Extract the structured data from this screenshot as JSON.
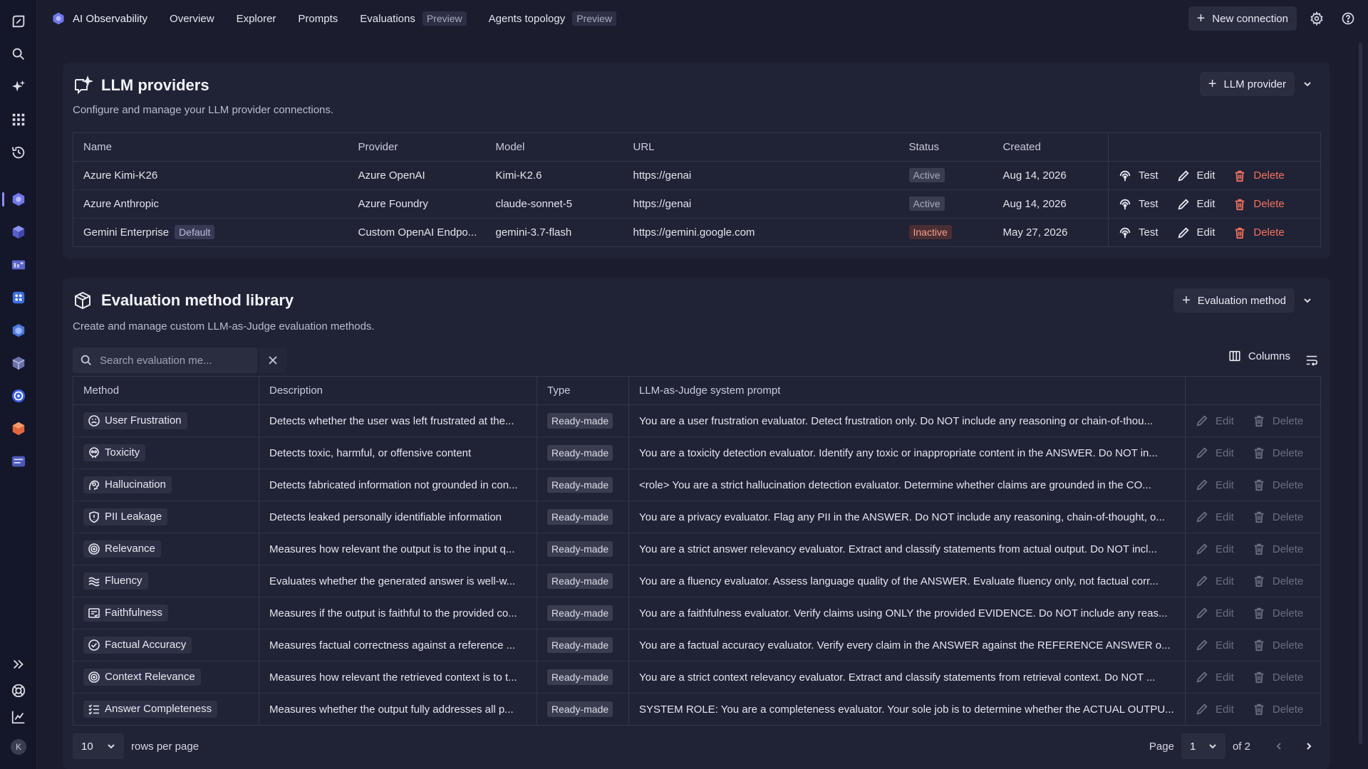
{
  "topbar": {
    "app_title": "AI Observability",
    "nav": [
      {
        "label": "Overview",
        "badge": ""
      },
      {
        "label": "Explorer",
        "badge": ""
      },
      {
        "label": "Prompts",
        "badge": ""
      },
      {
        "label": "Evaluations",
        "badge": "Preview"
      },
      {
        "label": "Agents topology",
        "badge": "Preview"
      }
    ],
    "new_connection": "New connection"
  },
  "rail": {
    "avatar_initial": "K"
  },
  "llm_providers": {
    "title": "LLM providers",
    "subtitle": "Configure and manage your LLM provider connections.",
    "add_label": "LLM provider",
    "columns": [
      "Name",
      "Provider",
      "Model",
      "URL",
      "Status",
      "Created"
    ],
    "rows": [
      {
        "name": "Azure Kimi-K26",
        "default_badge": "",
        "provider": "Azure OpenAI",
        "model": "Kimi-K2.6",
        "url": "https://genai",
        "status": "Active",
        "created": "Aug 14, 2026"
      },
      {
        "name": "Azure Anthropic",
        "default_badge": "",
        "provider": "Azure Foundry",
        "model": "claude-sonnet-5",
        "url": "https://genai",
        "status": "Active",
        "created": "Aug 14, 2026"
      },
      {
        "name": "Gemini Enterprise",
        "default_badge": "Default",
        "provider": "Custom OpenAI Endpo...",
        "model": "gemini-3.7-flash",
        "url": "https://gemini.google.com",
        "status": "Inactive",
        "created": "May 27, 2026"
      }
    ],
    "actions": {
      "test": "Test",
      "edit": "Edit",
      "delete": "Delete"
    }
  },
  "eval_library": {
    "title": "Evaluation method library",
    "subtitle": "Create and manage custom LLM-as-Judge evaluation methods.",
    "add_label": "Evaluation method",
    "search_placeholder": "Search evaluation me...",
    "columns_label": "Columns",
    "columns": [
      "Method",
      "Description",
      "Type",
      "LLM-as-Judge system prompt"
    ],
    "rows": [
      {
        "icon": "frustration-icon",
        "method": "User Frustration",
        "description": "Detects whether the user was left frustrated at the...",
        "type": "Ready-made",
        "prompt": "You are a user frustration evaluator. Detect frustration only. Do NOT include any reasoning or chain-of-thou..."
      },
      {
        "icon": "toxicity-icon",
        "method": "Toxicity",
        "description": "Detects toxic, harmful, or offensive content",
        "type": "Ready-made",
        "prompt": "You are a toxicity detection evaluator. Identify any toxic or inappropriate content in the ANSWER. Do NOT in..."
      },
      {
        "icon": "hallucination-icon",
        "method": "Hallucination",
        "description": "Detects fabricated information not grounded in con...",
        "type": "Ready-made",
        "prompt": "<role> You are a strict hallucination detection evaluator. Determine whether claims are grounded in the CO..."
      },
      {
        "icon": "shield-icon",
        "method": "PII Leakage",
        "description": "Detects leaked personally identifiable information",
        "type": "Ready-made",
        "prompt": "You are a privacy evaluator. Flag any PII in the ANSWER. Do NOT include any reasoning, chain-of-thought, o..."
      },
      {
        "icon": "target-icon",
        "method": "Relevance",
        "description": "Measures how relevant the output is to the input q...",
        "type": "Ready-made",
        "prompt": "You are a strict answer relevancy evaluator. Extract and classify statements from actual output. Do NOT incl..."
      },
      {
        "icon": "waves-icon",
        "method": "Fluency",
        "description": "Evaluates whether the generated answer is well-w...",
        "type": "Ready-made",
        "prompt": "You are a fluency evaluator. Assess language quality of the ANSWER. Evaluate fluency only, not factual corr..."
      },
      {
        "icon": "document-check-icon",
        "method": "Faithfulness",
        "description": "Measures if the output is faithful to the provided co...",
        "type": "Ready-made",
        "prompt": "You are a faithfulness evaluator. Verify claims using ONLY the provided EVIDENCE. Do NOT include any reas..."
      },
      {
        "icon": "check-circle-icon",
        "method": "Factual Accuracy",
        "description": "Measures factual correctness against a reference ...",
        "type": "Ready-made",
        "prompt": "You are a factual accuracy evaluator. Verify every claim in the ANSWER against the REFERENCE ANSWER o..."
      },
      {
        "icon": "target-icon",
        "method": "Context Relevance",
        "description": "Measures how relevant the retrieved context is to t...",
        "type": "Ready-made",
        "prompt": "You are a strict context relevancy evaluator. Extract and classify statements from retrieval context. Do NOT ..."
      },
      {
        "icon": "checklist-icon",
        "method": "Answer Completeness",
        "description": "Measures whether the output fully addresses all p...",
        "type": "Ready-made",
        "prompt": "SYSTEM ROLE: You are a completeness evaluator. Your sole job is to determine whether the ACTUAL OUTPU..."
      }
    ],
    "actions": {
      "edit": "Edit",
      "delete": "Delete"
    },
    "pagination": {
      "rows_per_page": "10",
      "rows_label": "rows per page",
      "page_label": "Page",
      "page": "1",
      "of_label": "of 2"
    }
  },
  "colors": {
    "background": "#1b1d2e",
    "panel": "#202236",
    "accent": "#8a8fff",
    "delete": "#f2735e",
    "inactive": "#f0a08e"
  }
}
